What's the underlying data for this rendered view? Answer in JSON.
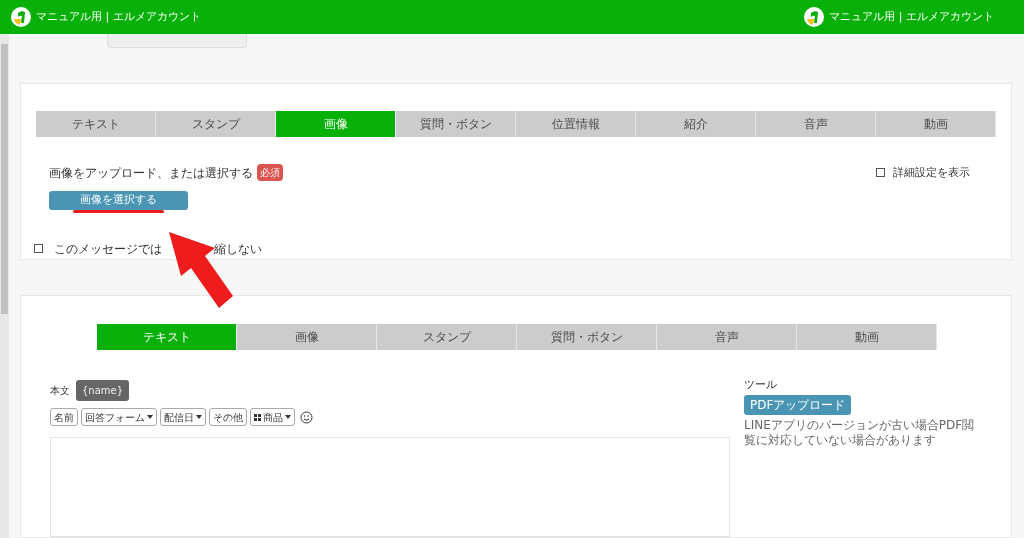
{
  "header": {
    "brand_left": "マニュアル用 | エルメアカウント",
    "brand_right": "マニュアル用 | エルメアカウント"
  },
  "message_card": {
    "tabs": [
      {
        "label": "テキスト",
        "selected": false
      },
      {
        "label": "スタンプ",
        "selected": false
      },
      {
        "label": "画像",
        "selected": true
      },
      {
        "label": "質問・ボタン",
        "selected": false
      },
      {
        "label": "位置情報",
        "selected": false
      },
      {
        "label": "紹介",
        "selected": false
      },
      {
        "label": "音声",
        "selected": false
      },
      {
        "label": "動画",
        "selected": false
      }
    ],
    "upload_label": "画像をアップロード、または選択する",
    "required_badge": "必須",
    "advanced": {
      "label": "詳細設定を表示",
      "checked": false
    },
    "select_button": "画像を選択する",
    "url_option": {
      "label_before": "このメッセージでは",
      "label_after": "縮しない",
      "checked": false
    }
  },
  "reply_card": {
    "tabs": [
      {
        "label": "テキスト",
        "selected": true
      },
      {
        "label": "画像",
        "selected": false
      },
      {
        "label": "スタンプ",
        "selected": false
      },
      {
        "label": "質問・ボタン",
        "selected": false
      },
      {
        "label": "音声",
        "selected": false
      },
      {
        "label": "動画",
        "selected": false
      }
    ],
    "body_label": "本文",
    "name_tag": "{name}",
    "insert_buttons": [
      {
        "label": "名前",
        "dropdown": false,
        "icon": false
      },
      {
        "label": "回答フォーム",
        "dropdown": true,
        "icon": false
      },
      {
        "label": "配信日",
        "dropdown": true,
        "icon": false
      },
      {
        "label": "その他",
        "dropdown": false,
        "icon": false
      },
      {
        "label": "商品",
        "dropdown": true,
        "icon": true
      }
    ],
    "tools_title": "ツール",
    "pdf_button": "PDFアップロード",
    "pdf_note": "LINEアプリのバージョンが古い場合PDF閲覧に対応していない場合があります"
  }
}
